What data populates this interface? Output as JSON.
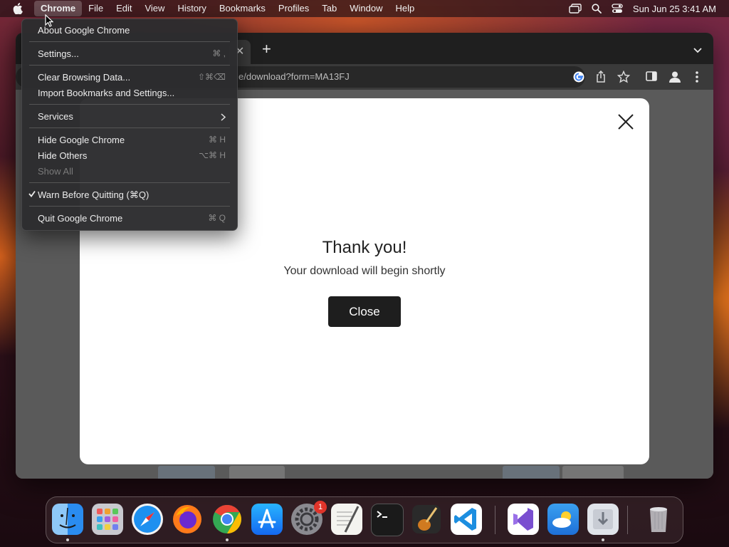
{
  "menubar": {
    "app_name": "Chrome",
    "items": [
      "File",
      "Edit",
      "View",
      "History",
      "Bookmarks",
      "Profiles",
      "Tab",
      "Window",
      "Help"
    ],
    "clock": "Sun Jun 25  3:41 AM"
  },
  "browser": {
    "url": "e/download?form=MA13FJ"
  },
  "modal": {
    "title": "Thank you!",
    "subtitle": "Your download will begin shortly",
    "button_label": "Close"
  },
  "app_menu": {
    "items": [
      {
        "label": "About Google Chrome",
        "shortcut": ""
      },
      {
        "label": "Settings...",
        "shortcut": "⌘ ,"
      },
      {
        "label": "Clear Browsing Data...",
        "shortcut": "⇧⌘⌫"
      },
      {
        "label": "Import Bookmarks and Settings...",
        "shortcut": ""
      },
      {
        "label": "Services",
        "shortcut": ""
      },
      {
        "label": "Hide Google Chrome",
        "shortcut": "⌘ H"
      },
      {
        "label": "Hide Others",
        "shortcut": "⌥⌘ H"
      },
      {
        "label": "Show All",
        "shortcut": "",
        "disabled": true
      },
      {
        "label": "Warn Before Quitting (⌘Q)",
        "shortcut": "",
        "checked": true
      },
      {
        "label": "Quit Google Chrome",
        "shortcut": "⌘ Q"
      }
    ]
  },
  "dock": {
    "apps": [
      "finder-icon",
      "launchpad-icon",
      "safari-icon",
      "firefox-icon",
      "chrome-icon",
      "app-store-icon",
      "system-settings-icon",
      "textedit-icon",
      "terminal-icon",
      "garageband-icon",
      "vscode-icon",
      "visual-studio-icon",
      "weather-icon",
      "downloads-icon",
      "trash-icon"
    ],
    "settings_badge": "1"
  },
  "colors": {
    "menu_bg": "#2c2c2e",
    "modal_button": "#1e1e1e",
    "badge": "#e0342a"
  }
}
